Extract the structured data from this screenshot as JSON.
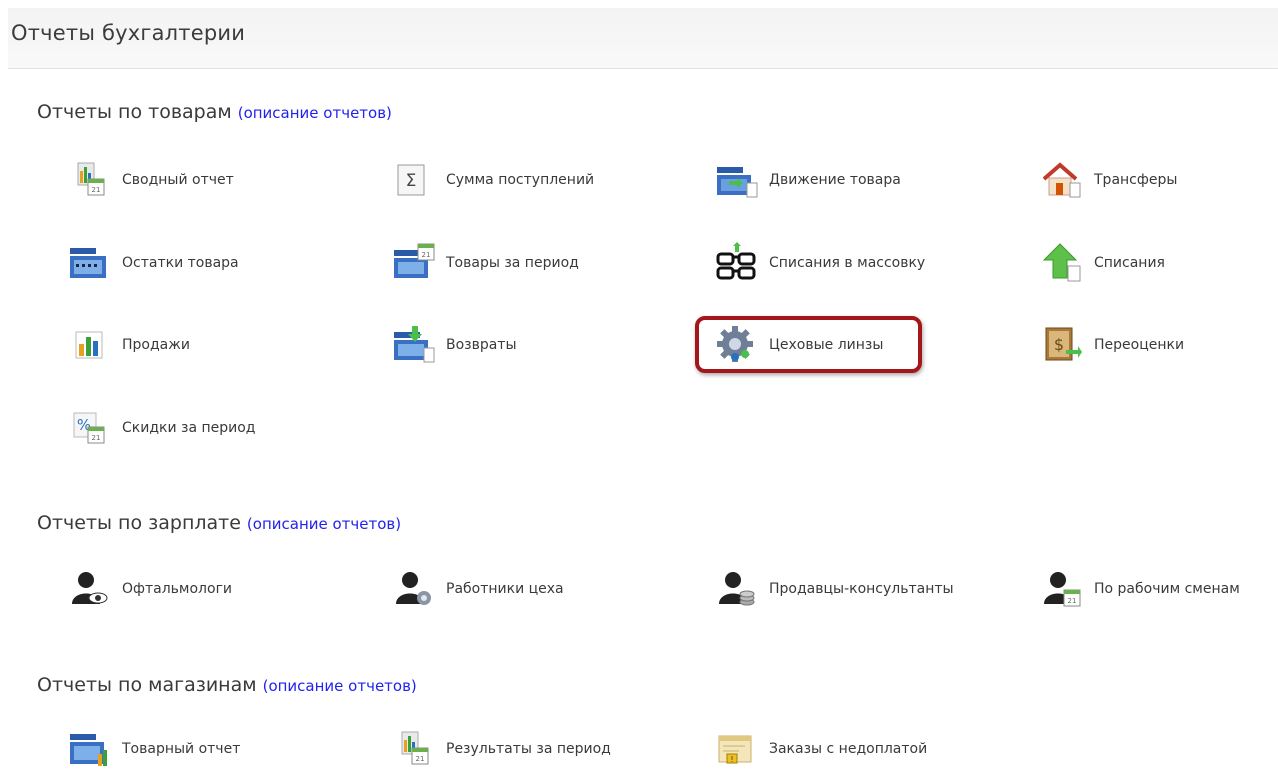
{
  "page": {
    "title": "Отчеты бухгалтерии"
  },
  "sections": [
    {
      "title": "Отчеты по товарам",
      "desc": "(описание отчетов)",
      "items": [
        {
          "label": "Сводный отчет",
          "icon": "chart-calendar-icon"
        },
        {
          "label": "Сумма поступлений",
          "icon": "sigma-icon"
        },
        {
          "label": "Движение товара",
          "icon": "register-arrows-icon"
        },
        {
          "label": "Трансферы",
          "icon": "house-icon"
        },
        {
          "label": "Остатки товара",
          "icon": "cash-register-icon"
        },
        {
          "label": "Товары за период",
          "icon": "register-calendar-icon"
        },
        {
          "label": "Списания в массовку",
          "icon": "glasses-icon"
        },
        {
          "label": "Списания",
          "icon": "green-up-arrow-icon"
        },
        {
          "label": "Продажи",
          "icon": "bar-chart-icon"
        },
        {
          "label": "Возвраты",
          "icon": "register-return-icon"
        },
        {
          "label": "Цеховые линзы",
          "icon": "gear-icon"
        },
        {
          "label": "Переоценки",
          "icon": "price-book-icon"
        },
        {
          "label": "Скидки за период",
          "icon": "percent-calendar-icon"
        }
      ]
    },
    {
      "title": "Отчеты по зарплате",
      "desc": "(описание отчетов)",
      "items": [
        {
          "label": "Офтальмологи",
          "icon": "person-eye-icon"
        },
        {
          "label": "Работники цеха",
          "icon": "person-gear-icon"
        },
        {
          "label": "Продавцы-консультанты",
          "icon": "person-coins-icon"
        },
        {
          "label": "По рабочим сменам",
          "icon": "person-calendar-icon"
        }
      ]
    },
    {
      "title": "Отчеты по магазинам",
      "desc": "(описание отчетов)",
      "items": [
        {
          "label": "Товарный отчет",
          "icon": "register-chart-icon"
        },
        {
          "label": "Результаты за период",
          "icon": "chart-calendar-icon"
        },
        {
          "label": "Заказы с недоплатой",
          "icon": "order-warning-icon"
        }
      ]
    }
  ],
  "calendar_digit": "21",
  "colors": {
    "link": "#2222ee",
    "highlight": "#a3171b"
  }
}
